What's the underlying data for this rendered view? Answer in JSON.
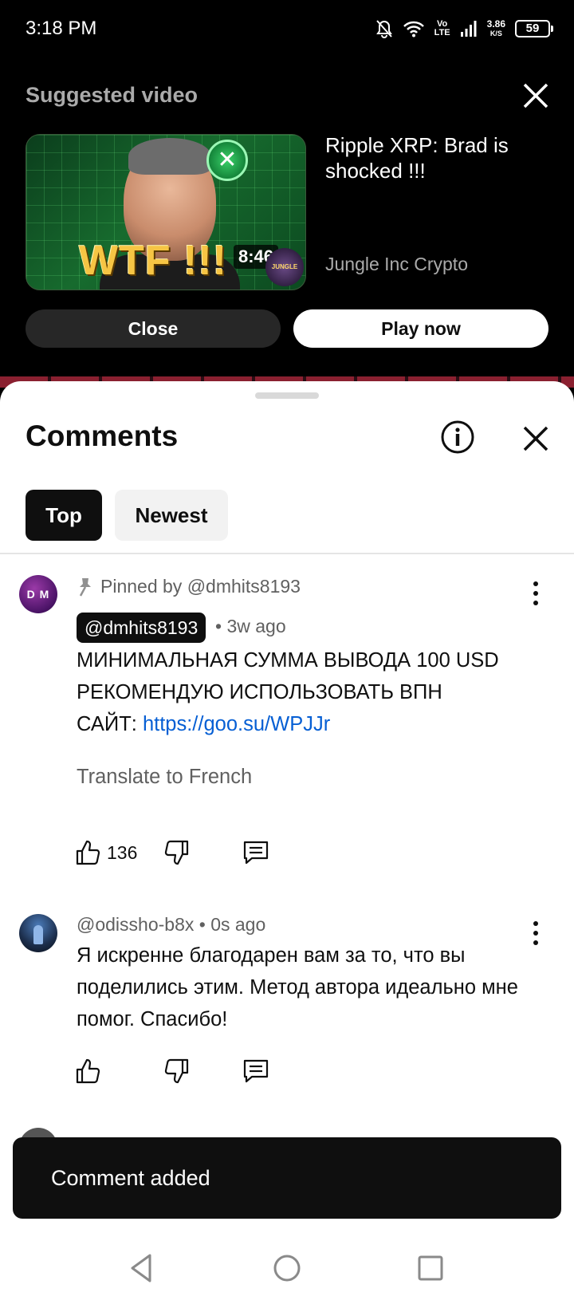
{
  "status_bar": {
    "time": "3:18 PM",
    "net_type_top": "Vo",
    "net_type_bottom": "LTE",
    "speed_value": "3.86",
    "speed_unit": "K/S",
    "battery": "59"
  },
  "suggested": {
    "header": "Suggested video",
    "thumbnail_overlay_text": "WTF !!!",
    "duration": "8:46",
    "video_title": "Ripple XRP: Brad is shocked !!!",
    "channel": "Jungle Inc Crypto",
    "close_label": "Close",
    "play_label": "Play now"
  },
  "comments_sheet": {
    "title": "Comments",
    "filters": [
      {
        "label": "Top",
        "selected": true
      },
      {
        "label": "Newest",
        "selected": false
      }
    ]
  },
  "comments": [
    {
      "pinned_label": "Pinned by @dmhits8193",
      "avatar_text": "D M",
      "author": "@dmhits8193",
      "age": "• 3w ago",
      "text_line1": "МИНИМАЛЬНАЯ СУММА ВЫВОДА 100 USD",
      "text_line2": "РЕКОМЕНДУЮ ИСПОЛЬЗОВАТЬ ВПН",
      "text_line3_prefix": "САЙТ: ",
      "link": "https://goo.su/WPJJr",
      "translate_label": "Translate to French",
      "likes": "136"
    },
    {
      "author_line": "@odissho-b8x • 0s ago",
      "text": "Я искренне благодарен вам за то, что вы поделились этим. Метод автора идеально мне помог. Спасибо!"
    }
  ],
  "snackbar": {
    "message": "Comment added"
  },
  "icons": {
    "pin": "pin-icon",
    "more": "more-vert-icon",
    "like": "thumb-up-icon",
    "dislike": "thumb-down-icon",
    "reply": "comment-icon",
    "info": "info-icon",
    "close": "close-icon"
  },
  "colors": {
    "link": "#065fd4",
    "chip_selected_bg": "#0f0f0f",
    "chip_bg": "#f2f2f2",
    "secondary_text": "#606060"
  }
}
